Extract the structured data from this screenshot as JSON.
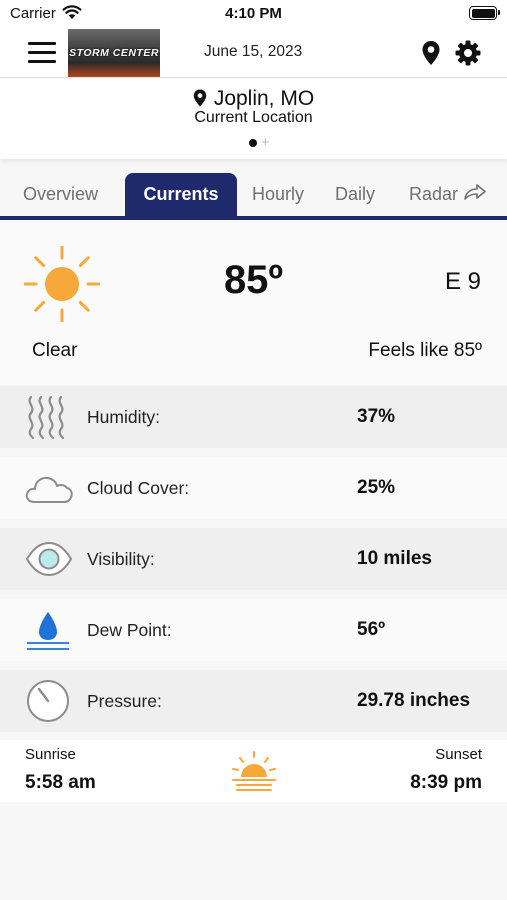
{
  "status_bar": {
    "carrier": "Carrier",
    "time": "4:10 PM"
  },
  "header": {
    "logo_text": "STORM CENTER",
    "date": "June 15, 2023"
  },
  "location": {
    "name": "Joplin, MO",
    "subtitle": "Current Location",
    "add_symbol": "+"
  },
  "tabs": [
    {
      "label": "Overview"
    },
    {
      "label": "Currents",
      "active": true
    },
    {
      "label": "Hourly"
    },
    {
      "label": "Daily"
    },
    {
      "label": "Radar"
    }
  ],
  "current": {
    "temperature": "85º",
    "wind": "E 9",
    "condition": "Clear",
    "feels_like": "Feels like 85º",
    "icon": "sun-icon"
  },
  "details": [
    {
      "label": "Humidity:",
      "value": "37%",
      "icon": "humidity-icon"
    },
    {
      "label": "Cloud Cover:",
      "value": "25%",
      "icon": "cloud-icon"
    },
    {
      "label": "Visibility:",
      "value": "10 miles",
      "icon": "eye-icon"
    },
    {
      "label": "Dew Point:",
      "value": "56º",
      "icon": "water-drop-icon"
    },
    {
      "label": "Pressure:",
      "value": "29.78 inches",
      "icon": "gauge-icon"
    }
  ],
  "sun": {
    "sunrise_label": "Sunrise",
    "sunrise_time": "5:58 am",
    "sunset_label": "Sunset",
    "sunset_time": "8:39 pm"
  },
  "colors": {
    "accent": "#1f2a6d",
    "sun": "#f7a83a",
    "drop": "#1f72d6"
  }
}
